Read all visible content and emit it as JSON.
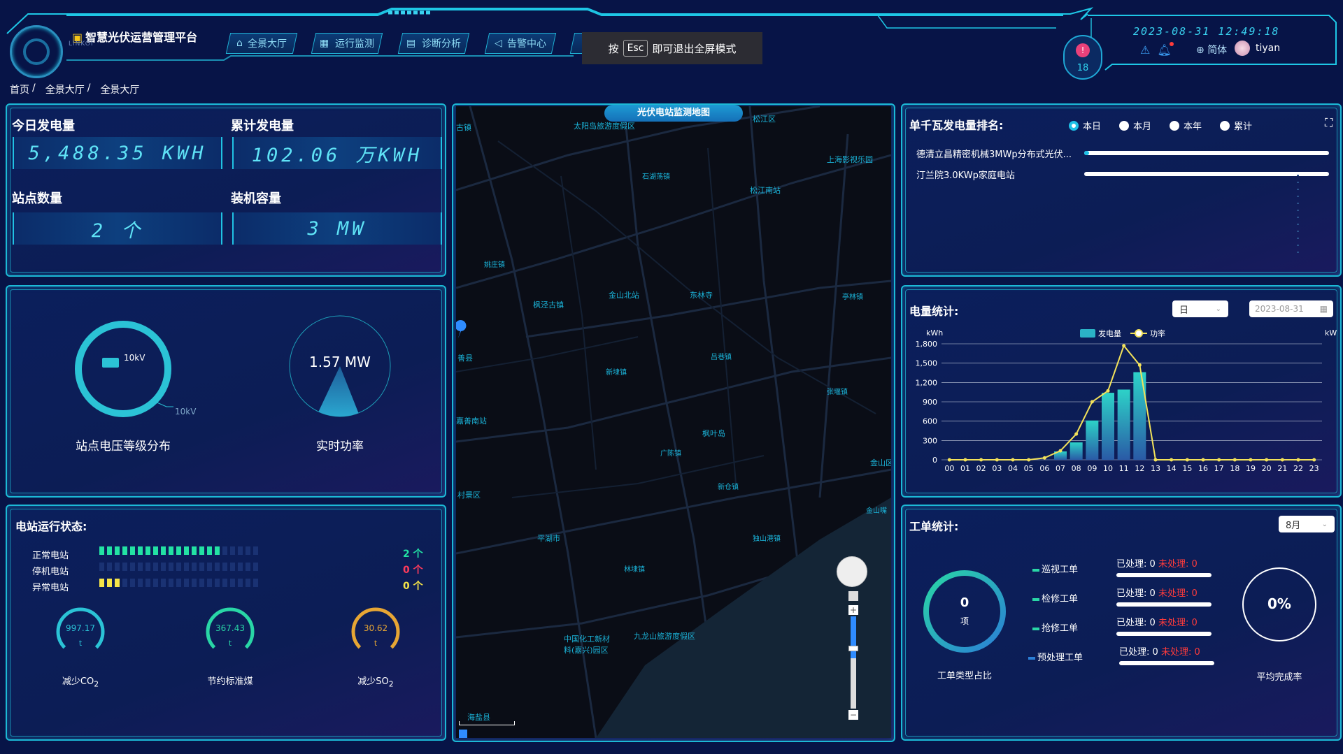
{
  "header": {
    "brand": "智慧光伏运营管理平台",
    "brand_sub": "LINKOI",
    "nav": [
      {
        "label": "全景大厅",
        "icon": "building-icon"
      },
      {
        "label": "运行监测",
        "icon": "grid-icon"
      },
      {
        "label": "诊断分析",
        "icon": "document-icon"
      },
      {
        "label": "告警中心",
        "icon": "speaker-icon"
      }
    ],
    "esc_tip": {
      "before": "按",
      "key": "Esc",
      "after": "即可退出全屏模式"
    },
    "alarm_count": "18",
    "datetime": "2023-08-31 12:49:18",
    "language": "简体",
    "username": "tiyan"
  },
  "breadcrumb": [
    "首页",
    "/",
    "全景大厅",
    "/",
    "全景大厅"
  ],
  "overview": {
    "today_label": "今日发电量",
    "today_value": "5,488.35 KWH",
    "total_label": "累计发电量",
    "total_value": "102.06 万KWH",
    "stations_label": "站点数量",
    "stations_value": "2 个",
    "capacity_label": "装机容量",
    "capacity_value": "3 MW"
  },
  "voltage": {
    "legend": "10kV",
    "slice_label": "10kV",
    "caption": "站点电压等级分布",
    "slices": [
      {
        "name": "10kV",
        "fraction": 1.0
      }
    ]
  },
  "power": {
    "value": "1.57 MW",
    "caption": "实时功率",
    "fill_fraction": 0.13
  },
  "station_status": {
    "title": "电站运行状态:",
    "rows": [
      {
        "label": "正常电站",
        "count": "2 个",
        "filled": 16,
        "total": 21,
        "color": "#23e2a4",
        "count_color": "#23e2a4"
      },
      {
        "label": "停机电站",
        "count": "0 个",
        "filled": 0,
        "total": 21,
        "color": "#1a3a8e",
        "count_color": "#ff3b5c"
      },
      {
        "label": "异常电站",
        "count": "0 个",
        "filled": 3,
        "total": 21,
        "color": "#f6e548",
        "count_color": "#f6e548"
      }
    ],
    "gauges": [
      {
        "value": "997.17",
        "unit": "t",
        "label": "减少CO",
        "sub": "2",
        "color": "#2bc3d6",
        "level": 1.0
      },
      {
        "value": "367.43",
        "unit": "t",
        "label": "节约标准煤",
        "sub": "",
        "color": "#29d6a6",
        "level": 1.0
      },
      {
        "value": "30.62",
        "unit": "t",
        "label": "减少SO",
        "sub": "2",
        "color": "#e7a634",
        "level": 1.0
      }
    ]
  },
  "map": {
    "title": "光伏电站监测地图",
    "places": [
      "古镇",
      "太阳岛旅游度假区",
      "松江区",
      "上海影视乐园",
      "石湖荡镇",
      "松江南站",
      "枫泾古镇",
      "金山北站",
      "东林寺",
      "亭林镇",
      "吕巷镇",
      "新埭镇",
      "张堰镇",
      "嘉善南站",
      "枫叶岛",
      "广陈镇",
      "金山区",
      "新仓镇",
      "金山嘴",
      "平湖市",
      "独山港镇",
      "林埭镇",
      "中国化工新材",
      "料(嘉兴)园区",
      "九龙山旅游度假区",
      "海盐县",
      "善县",
      "村景区",
      "姚庄镇"
    ]
  },
  "ranking": {
    "title": "单千瓦发电量排名:",
    "options": [
      "本日",
      "本月",
      "本年",
      "累计"
    ],
    "selected": "本日",
    "items": [
      {
        "name": "德清立昌精密机械3MWp分布式光伏...",
        "fraction": 0.02
      },
      {
        "name": "汀兰院3.0KWp家庭电站",
        "fraction": 0.0
      }
    ]
  },
  "energy": {
    "title": "电量统计:",
    "period": "日",
    "date": "2023-08-31"
  },
  "chart_data": {
    "type": "bar",
    "title": "",
    "xlabel": "",
    "ylabel": "kWh",
    "y2label": "kW",
    "legend": [
      "发电量",
      "功率"
    ],
    "legend_position": "top-center",
    "categories": [
      "00",
      "01",
      "02",
      "03",
      "04",
      "05",
      "06",
      "07",
      "08",
      "09",
      "10",
      "11",
      "12",
      "13",
      "14",
      "15",
      "16",
      "17",
      "18",
      "19",
      "20",
      "21",
      "22",
      "23"
    ],
    "ylim": [
      0,
      1800
    ],
    "yticks": [
      "0",
      "300",
      "600",
      "900",
      "1,200",
      "1,500",
      "1,800"
    ],
    "grid": true,
    "series": [
      {
        "name": "发电量",
        "type": "bar",
        "values": [
          0,
          0,
          0,
          0,
          0,
          0,
          0,
          130,
          270,
          610,
          1040,
          1090,
          1360,
          0,
          0,
          0,
          0,
          0,
          0,
          0,
          0,
          0,
          0,
          0
        ]
      },
      {
        "name": "功率",
        "type": "line",
        "values": [
          0,
          0,
          0,
          0,
          0,
          0,
          30,
          140,
          400,
          900,
          1070,
          1770,
          1470,
          0,
          0,
          0,
          0,
          0,
          0,
          0,
          0,
          0,
          0,
          0
        ]
      }
    ]
  },
  "workorder": {
    "title": "工单统计:",
    "month": "8月",
    "total": "0",
    "total_unit": "项",
    "ring_caption": "工单类型占比",
    "types": [
      "巡视工单",
      "检修工单",
      "抢修工单",
      "预处理工单"
    ],
    "processed_label": "已处理:",
    "processed_value": "0",
    "unprocessed_label": "未处理:",
    "unprocessed_value": "0",
    "rate": "0%",
    "rate_caption": "平均完成率"
  }
}
